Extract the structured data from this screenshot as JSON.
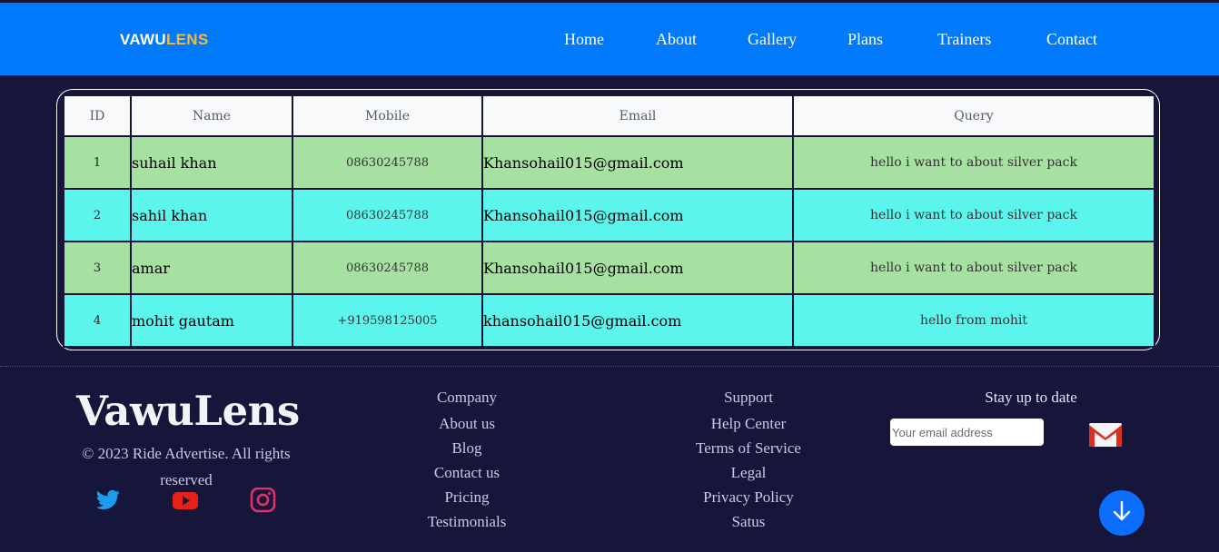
{
  "brand": {
    "part1": "VAWU",
    "part2": "LENS"
  },
  "nav": {
    "items": [
      "Home",
      "About",
      "Gallery",
      "Plans",
      "Trainers",
      "Contact"
    ]
  },
  "table": {
    "headers": [
      "ID",
      "Name",
      "Mobile",
      "Email",
      "Query"
    ],
    "rows": [
      {
        "id": "1",
        "name": "suhail khan",
        "mobile": "08630245788",
        "email": "Khansohail015@gmail.com",
        "query": "hello i want to about silver pack"
      },
      {
        "id": "2",
        "name": "sahil khan",
        "mobile": "08630245788",
        "email": "Khansohail015@gmail.com",
        "query": "hello i want to about silver pack"
      },
      {
        "id": "3",
        "name": "amar",
        "mobile": "08630245788",
        "email": "Khansohail015@gmail.com",
        "query": "hello i want to about silver pack"
      },
      {
        "id": "4",
        "name": "mohit gautam",
        "mobile": "+919598125005",
        "email": "khansohail015@gmail.com",
        "query": "hello from mohit"
      }
    ]
  },
  "footer": {
    "logo": "VawuLens",
    "copyright": "© 2023 Ride Advertise. All rights reserved",
    "social": [
      "twitter-icon",
      "youtube-icon",
      "instagram-icon"
    ],
    "company": {
      "title": "Company",
      "links": [
        "About us",
        "Blog",
        "Contact us",
        "Pricing",
        "Testimonials"
      ]
    },
    "support": {
      "title": "Support",
      "links": [
        "Help Center",
        "Terms of Service",
        "Legal",
        "Privacy Policy",
        "Satus"
      ]
    },
    "newsletter": {
      "title": "Stay up to date",
      "placeholder": "Your email address"
    }
  },
  "colors": {
    "navbar": "#0079fb",
    "background": "#15163a",
    "row_green": "#a6e1a2",
    "row_cyan": "#5bf5ee",
    "brand_accent": "#f6b93b",
    "fab": "#0d6efd"
  },
  "icons": {
    "gmail": "gmail-icon",
    "scroll": "arrow-down-icon"
  }
}
